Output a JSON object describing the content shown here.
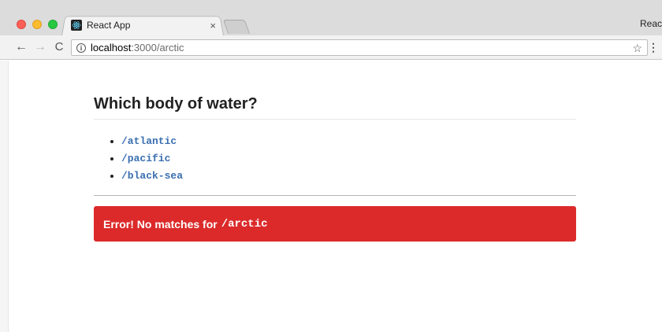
{
  "browser": {
    "tab_title": "React App",
    "tab_close": "×",
    "profile_label": "React",
    "url_host": "localhost",
    "url_rest": ":3000/arctic",
    "nav_back": "←",
    "nav_forward": "→",
    "nav_reload": "C",
    "bookmark_glyph": "☆",
    "menu_glyph": "⋮",
    "info_glyph": "i"
  },
  "page": {
    "heading": "Which body of water?",
    "links": [
      {
        "label": "/atlantic"
      },
      {
        "label": "/pacific"
      },
      {
        "label": "/black-sea"
      }
    ],
    "alert": {
      "prefix": "Error! No matches for",
      "path": "/arctic",
      "color": "#dc2a2a"
    }
  },
  "colors": {
    "link": "#3a6fb0",
    "chrome": "#dcdcdc",
    "toolbar": "#f2f2f2"
  }
}
